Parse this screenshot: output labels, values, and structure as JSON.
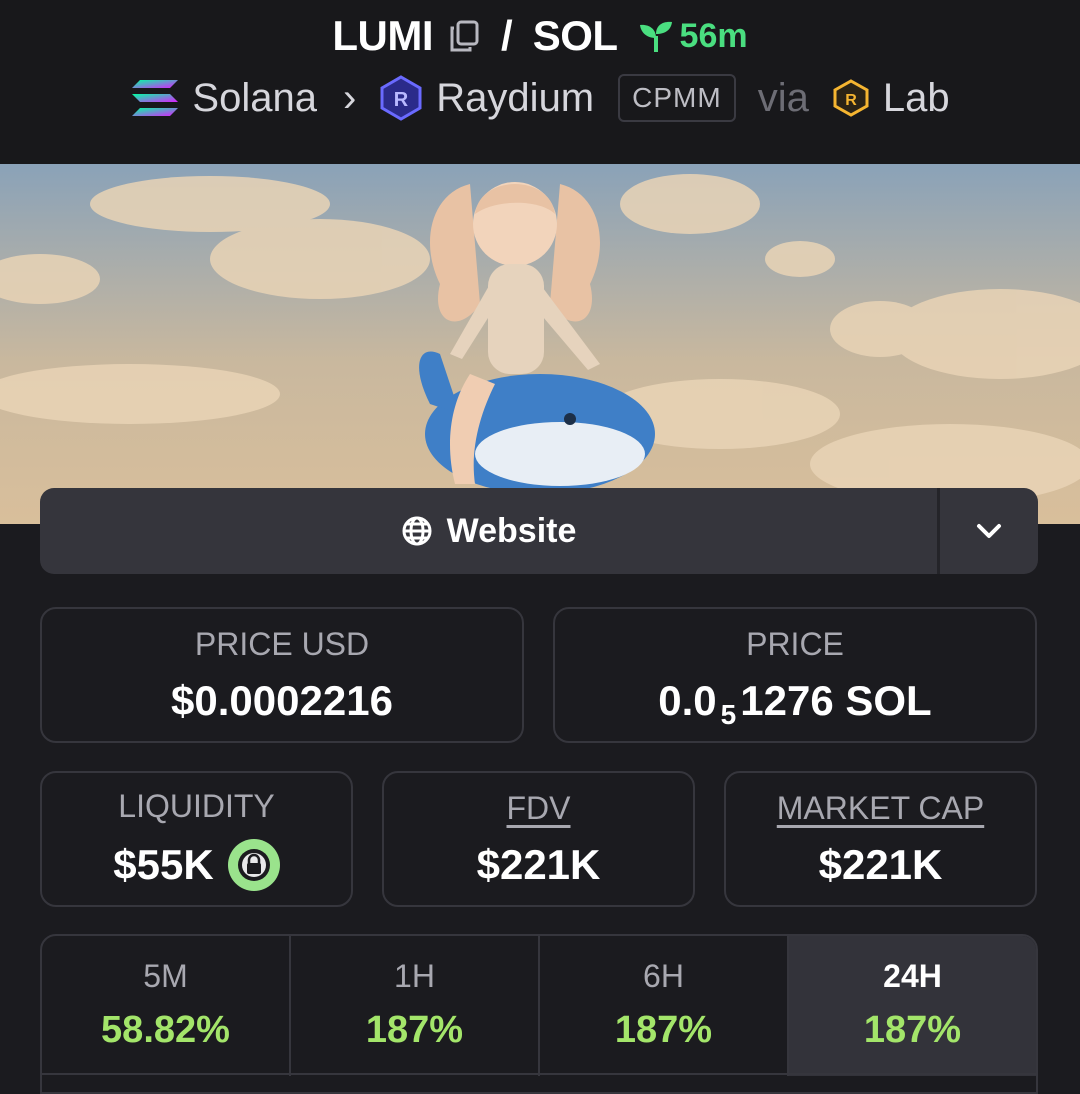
{
  "header": {
    "token": "LUMI",
    "quote": "SOL",
    "separator": "/",
    "age": "56m",
    "chain": "Solana",
    "dex": "Raydium",
    "pool_type": "CPMM",
    "via": "via",
    "launchpad": "Lab"
  },
  "website": {
    "label": "Website"
  },
  "stats": {
    "price_usd": {
      "label": "PRICE USD",
      "value": "$0.0002216"
    },
    "price": {
      "label": "PRICE",
      "prefix": "0.0",
      "zeros": "5",
      "suffix": "1276 SOL"
    },
    "liquidity": {
      "label": "LIQUIDITY",
      "value": "$55K"
    },
    "fdv": {
      "label": "FDV",
      "value": "$221K"
    },
    "market_cap": {
      "label": "MARKET CAP",
      "value": "$221K"
    }
  },
  "timeframes": [
    {
      "label": "5M",
      "value": "58.82%",
      "active": false
    },
    {
      "label": "1H",
      "value": "187%",
      "active": false
    },
    {
      "label": "6H",
      "value": "187%",
      "active": false
    },
    {
      "label": "24H",
      "value": "187%",
      "active": true
    }
  ],
  "colors": {
    "positive": "#a3e56a",
    "age": "#4ade80",
    "lock": "#9ae38c",
    "background": "#1b1b1f"
  }
}
